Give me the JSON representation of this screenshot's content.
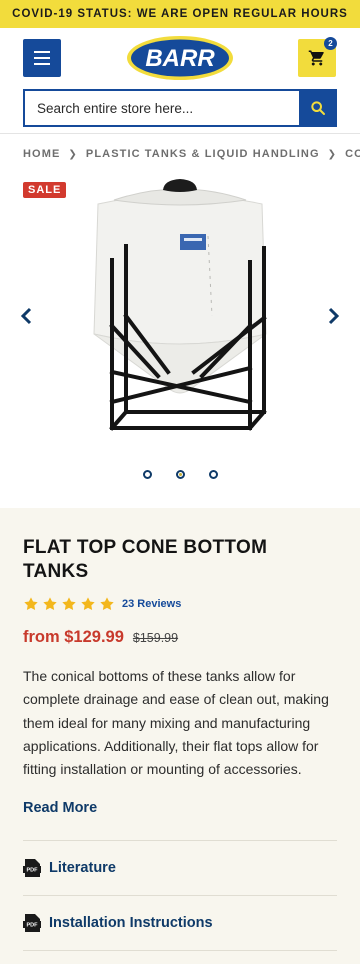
{
  "banner": {
    "text": "COVID-19 STATUS: WE ARE OPEN REGULAR HOURS"
  },
  "header": {
    "logo_text": "BARR",
    "cart_count": "2",
    "search_placeholder": "Search entire store here..."
  },
  "breadcrumb": {
    "items": [
      "HOME",
      "PLASTIC TANKS & LIQUID HANDLING",
      "CONE BOTTOM TANKS"
    ]
  },
  "gallery": {
    "badge": "SALE",
    "slide_count": 3,
    "active_slide": 2
  },
  "product": {
    "title": "FLAT TOP CONE BOTTOM TANKS",
    "rating": 5,
    "reviews": "23 Reviews",
    "price": "from $129.99",
    "old_price": "$159.99",
    "description": "The conical bottoms of these tanks allow for complete drainage and ease of clean out, making them ideal for many mixing and manufacturing applications. Additionally, their flat tops allow for fitting installation or mounting of accessories.",
    "read_more": "Read More"
  },
  "documents": [
    {
      "label": "Literature"
    },
    {
      "label": "Installation Instructions"
    }
  ],
  "colors": {
    "brand_blue": "#154a9a",
    "brand_yellow": "#f2dc3c",
    "sale_red": "#d23a2e",
    "star_gold": "#f3b71d"
  },
  "icons": {
    "menu": "hamburger-icon",
    "cart": "cart-icon",
    "search": "search-icon",
    "prev": "chevron-left-icon",
    "next": "chevron-right-icon",
    "star": "star-icon",
    "pdf": "pdf-icon"
  }
}
